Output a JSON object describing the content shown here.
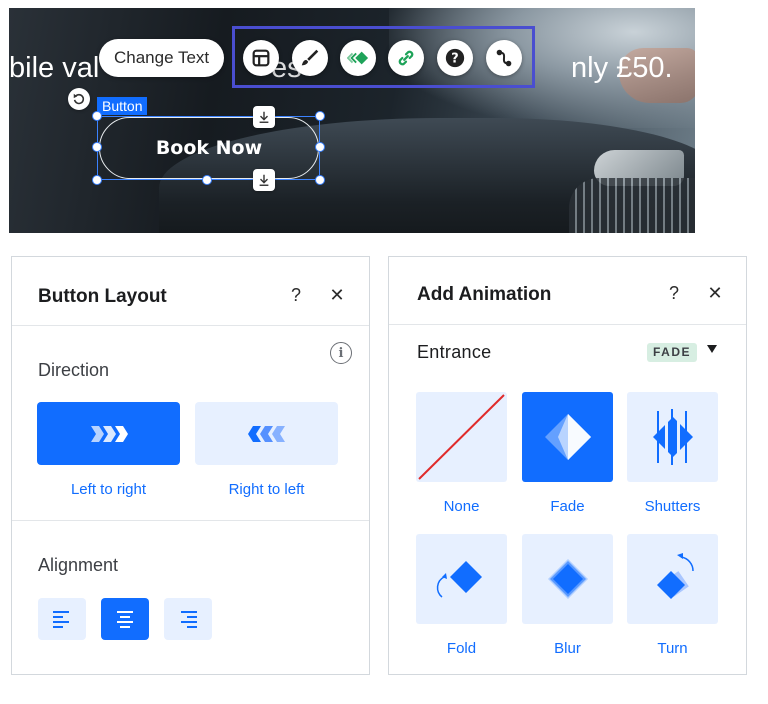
{
  "canvas": {
    "headline_left": "bile val",
    "headline_middle": "es",
    "headline_right": "nly £50.",
    "change_text_label": "Change Text",
    "element_tag": "Button",
    "button_text": "Book Now",
    "toolbar_icons": [
      "layout-icon",
      "design-brush-icon",
      "animation-icon",
      "link-icon",
      "help-icon",
      "connect-icon"
    ]
  },
  "button_layout_panel": {
    "title": "Button Layout",
    "help": "?",
    "close": "✕",
    "info": "i",
    "direction": {
      "label": "Direction",
      "options": [
        {
          "label": "Left to right",
          "selected": true
        },
        {
          "label": "Right to left",
          "selected": false
        }
      ]
    },
    "alignment": {
      "label": "Alignment",
      "options": [
        "left",
        "center",
        "right"
      ],
      "selected": "center"
    }
  },
  "add_animation_panel": {
    "title": "Add Animation",
    "help": "?",
    "close": "✕",
    "section_label": "Entrance",
    "filter_badge": "FADE",
    "options": [
      {
        "label": "None",
        "selected": false
      },
      {
        "label": "Fade",
        "selected": true
      },
      {
        "label": "Shutters",
        "selected": false
      },
      {
        "label": "Fold",
        "selected": false
      },
      {
        "label": "Blur",
        "selected": false
      },
      {
        "label": "Turn",
        "selected": false
      }
    ]
  },
  "colors": {
    "accent": "#116dff",
    "accent_light": "#e7f0ff",
    "toolbar_highlight": "#4a4ed0",
    "animation_green": "#1ea359",
    "none_slash": "#e02b2b"
  }
}
